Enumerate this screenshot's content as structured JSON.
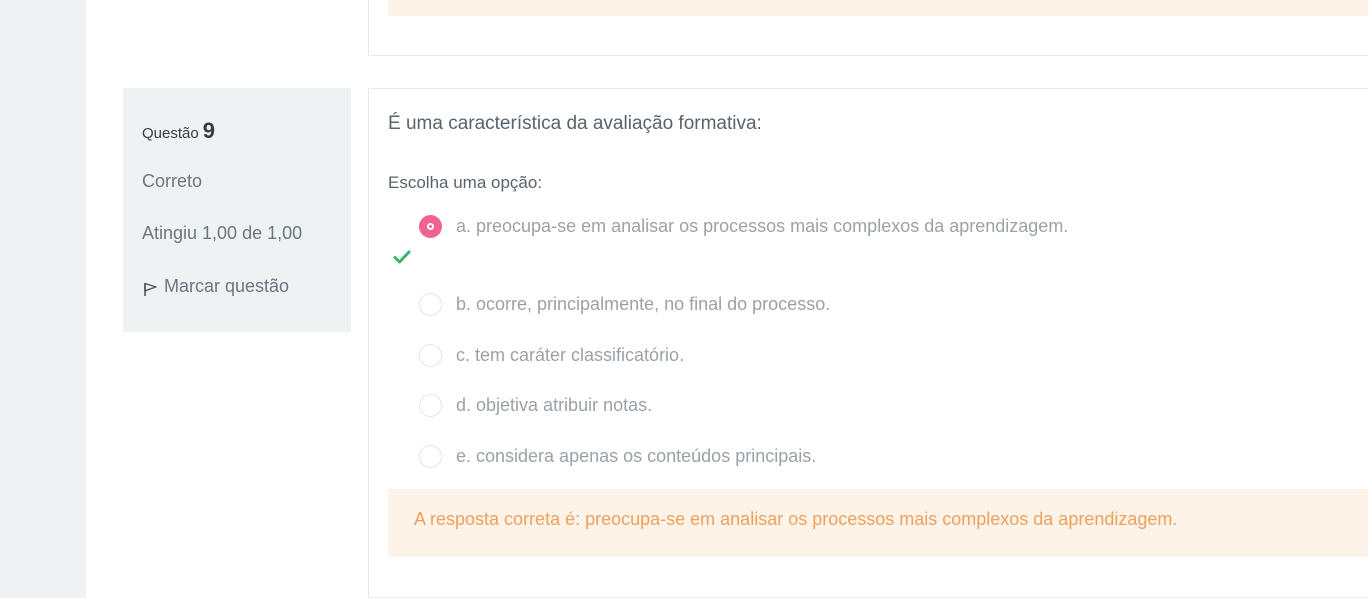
{
  "info": {
    "question_prefix": "Questão",
    "question_number": "9",
    "state": "Correto",
    "grade": "Atingiu 1,00 de 1,00",
    "flag_label": "Marcar questão"
  },
  "question": {
    "text": "É uma característica da avaliação formativa:",
    "prompt": "Escolha uma opção:",
    "options": [
      {
        "label": "a. preocupa-se em analisar os processos mais complexos da aprendizagem.",
        "selected": true,
        "correct": true
      },
      {
        "label": "b. ocorre, principalmente, no final do processo.",
        "selected": false
      },
      {
        "label": "c. tem caráter classificatório.",
        "selected": false
      },
      {
        "label": "d. objetiva atribuir notas.",
        "selected": false
      },
      {
        "label": "e. considera apenas os conteúdos principais.",
        "selected": false
      }
    ],
    "feedback": "A resposta correta é: preocupa-se em analisar os processos mais complexos da aprendizagem."
  },
  "colors": {
    "selected_radio": "#f06292",
    "check": "#3cb371",
    "feedback_bg": "#fdf3e8",
    "feedback_text": "#f0a05a"
  },
  "icons": [
    "flag-icon",
    "check-icon"
  ]
}
